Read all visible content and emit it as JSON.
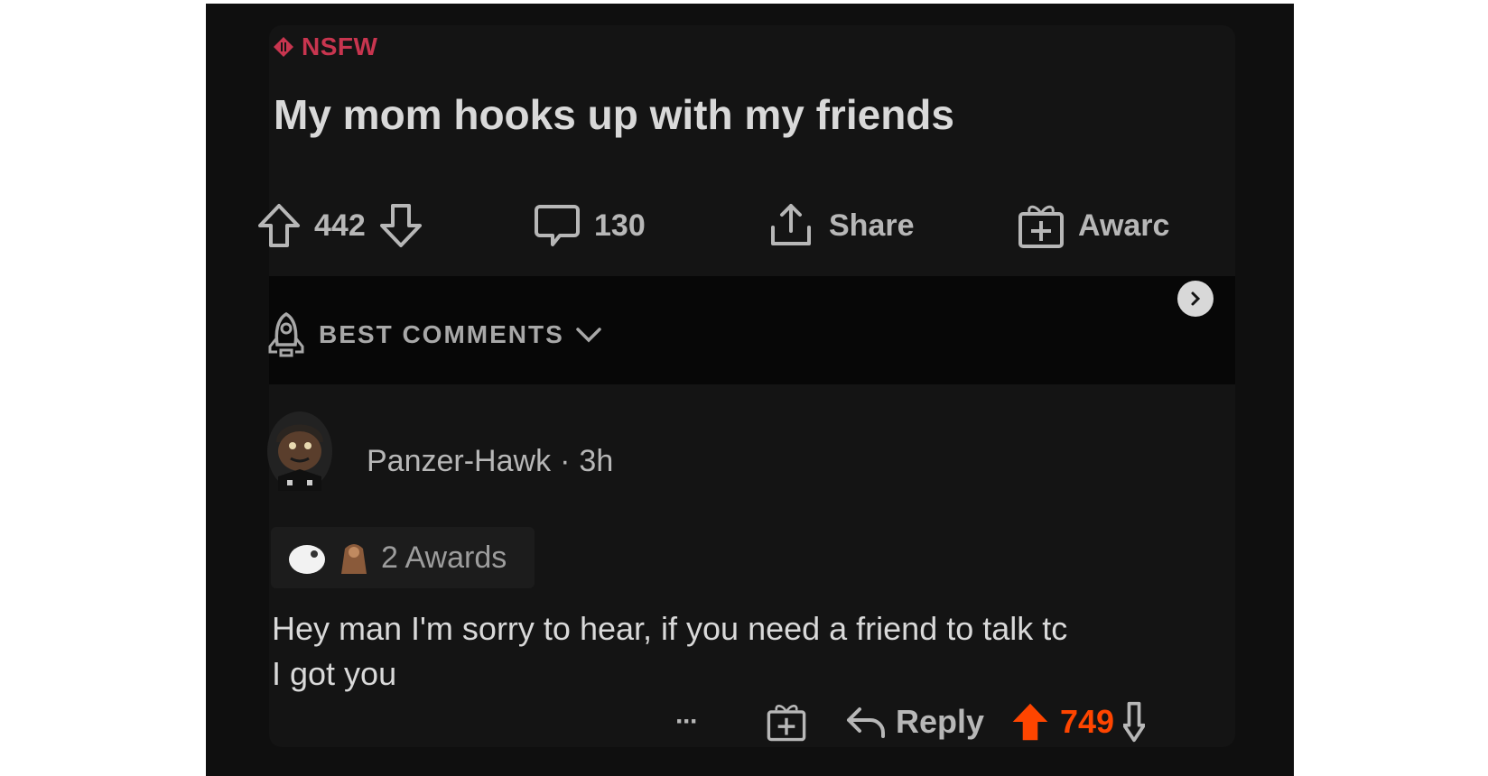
{
  "post": {
    "nsfw_label": "NSFW",
    "title": "My mom hooks up with my friends",
    "actions": {
      "upvotes": "442",
      "comments": "130",
      "share_label": "Share",
      "award_label": "Awarc"
    }
  },
  "comments_header": {
    "sort_label": "BEST COMMENTS"
  },
  "comment": {
    "username": "Panzer-Hawk",
    "separator": "·",
    "age": "3h",
    "awards_label": "2 Awards",
    "text_line1": "Hey man I'm sorry to hear, if you need a friend to talk tc",
    "text_line2": "I got you",
    "more_label": "···",
    "reply_label": "Reply",
    "score": "749"
  },
  "colors": {
    "background": "#0f0f0f",
    "nsfw": "#c8354f",
    "upvote_active": "#ff4500",
    "text": "#d9d9d9"
  }
}
